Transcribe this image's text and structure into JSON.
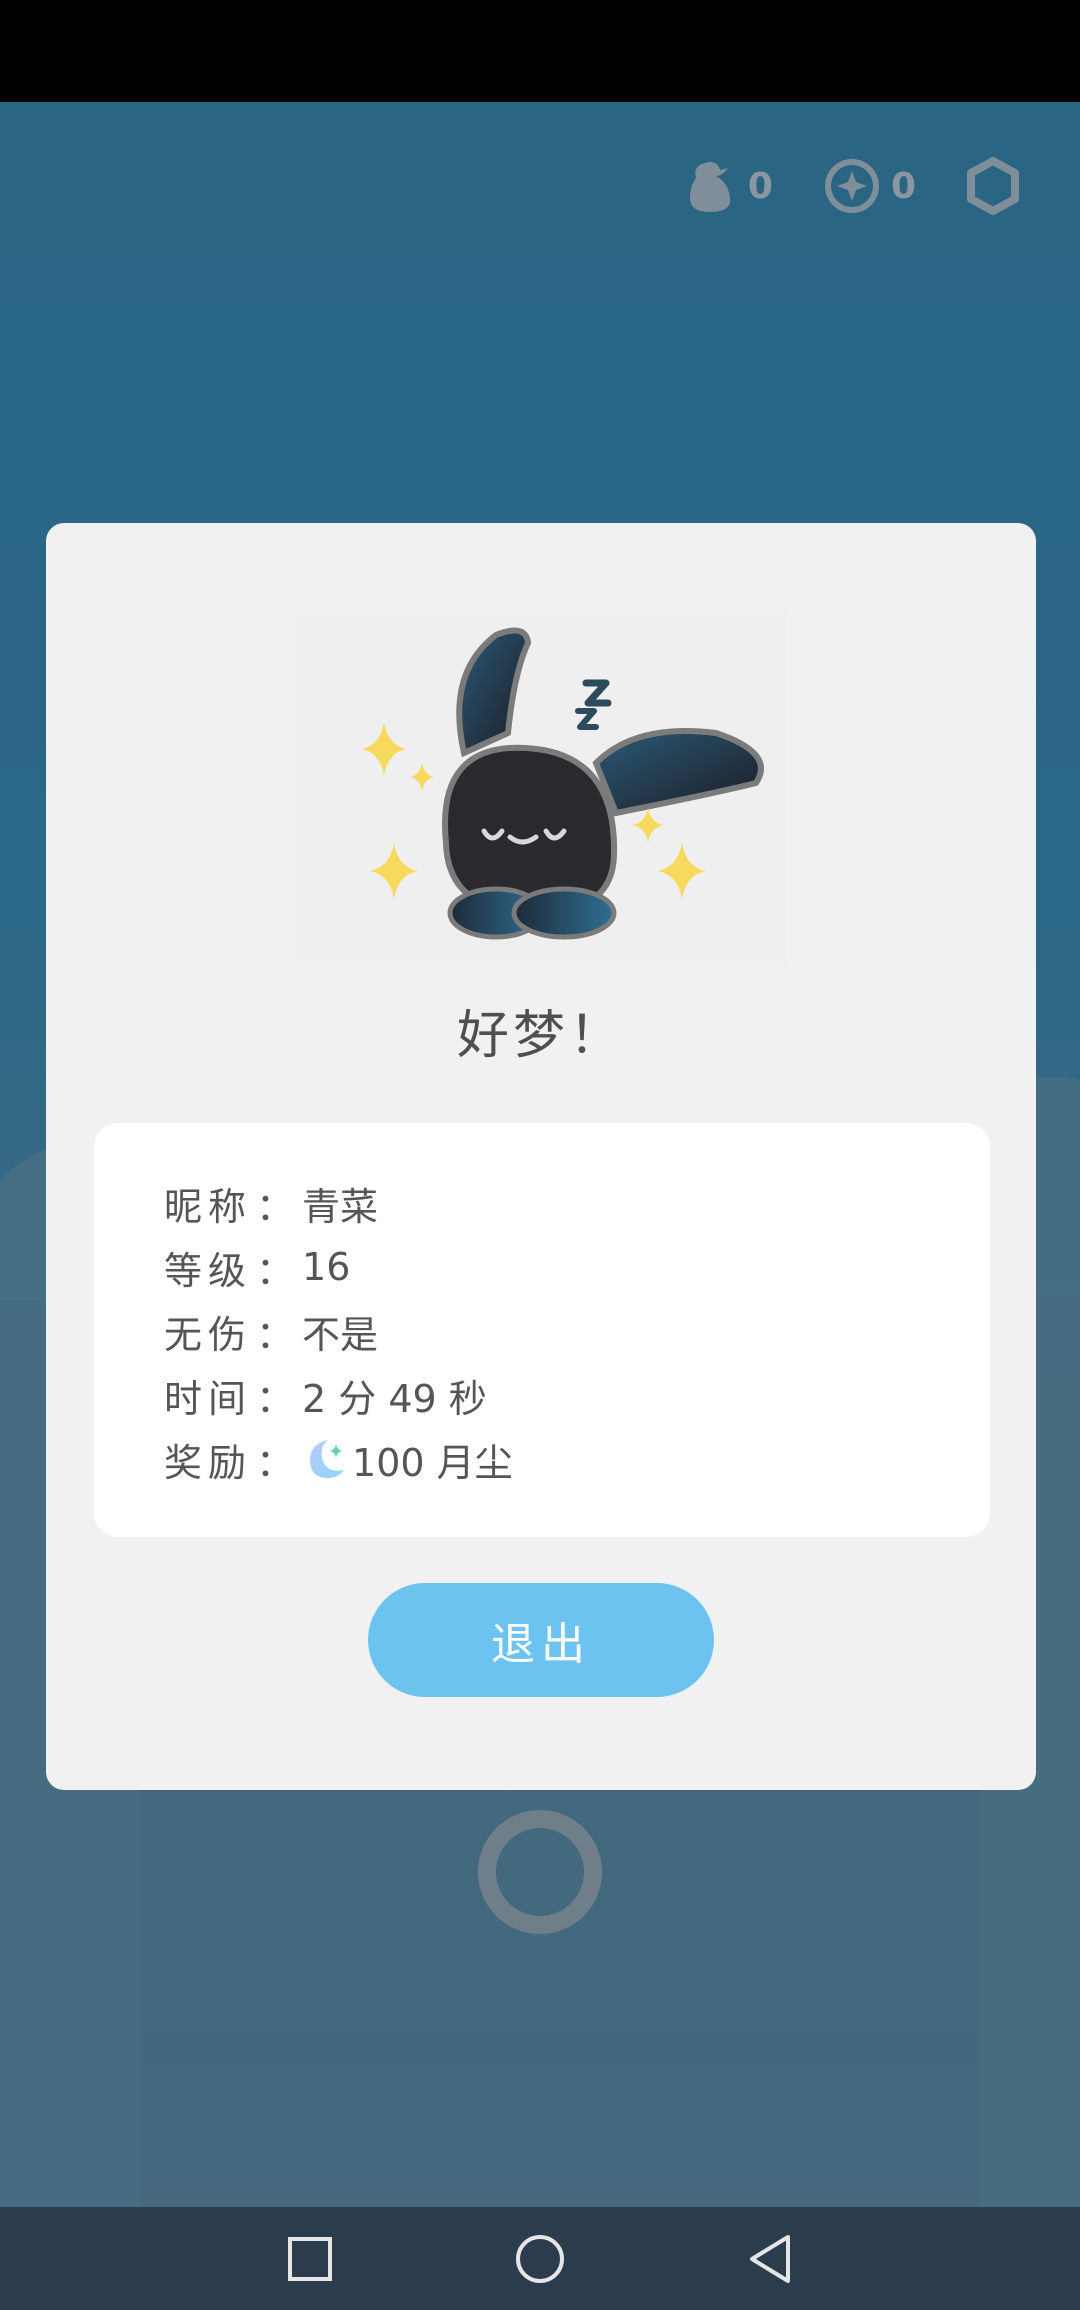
{
  "hud": {
    "bag_count": "0",
    "coin_count": "0",
    "icons": [
      "bag-icon",
      "coin-icon",
      "settings-icon"
    ]
  },
  "dialog": {
    "title": "好梦！",
    "info": {
      "nickname_label": "昵称",
      "nickname_value": "青菜",
      "level_label": "等级",
      "level_value": "16",
      "nohit_label": "无伤",
      "nohit_value": "不是",
      "time_label": "时间",
      "time_value": "2 分 49 秒",
      "reward_label": "奖励",
      "reward_value": "100 月尘"
    },
    "separator": "：",
    "exit_label": "退出"
  },
  "nav": {
    "icons": [
      "recents-icon",
      "home-icon",
      "back-icon"
    ]
  },
  "colors": {
    "background": "#2a6584",
    "dialog": "#f1f1f1",
    "card": "#ffffff",
    "button": "#6cc3ef",
    "text": "#555555",
    "navbar": "#2b3c4c"
  }
}
